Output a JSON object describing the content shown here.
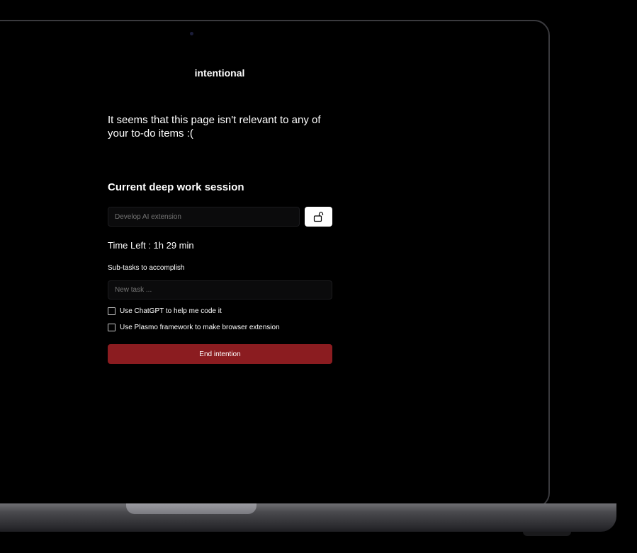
{
  "app": {
    "title": "intentional"
  },
  "message": "It seems that this page isn't relevant to any of your to-do items :(",
  "session": {
    "heading": "Current deep work session",
    "placeholder": "Develop AI extension",
    "lock_icon": "unlock-icon",
    "time_left": "Time Left : 1h 29 min"
  },
  "subtasks": {
    "label": "Sub-tasks to accomplish",
    "new_task_placeholder": "New task ...",
    "items": [
      {
        "label": "Use ChatGPT to help me code it",
        "checked": false
      },
      {
        "label": "Use Plasmo framework to make browser extension",
        "checked": false
      }
    ]
  },
  "actions": {
    "end_label": "End intention",
    "end_color": "#8b1c20"
  }
}
